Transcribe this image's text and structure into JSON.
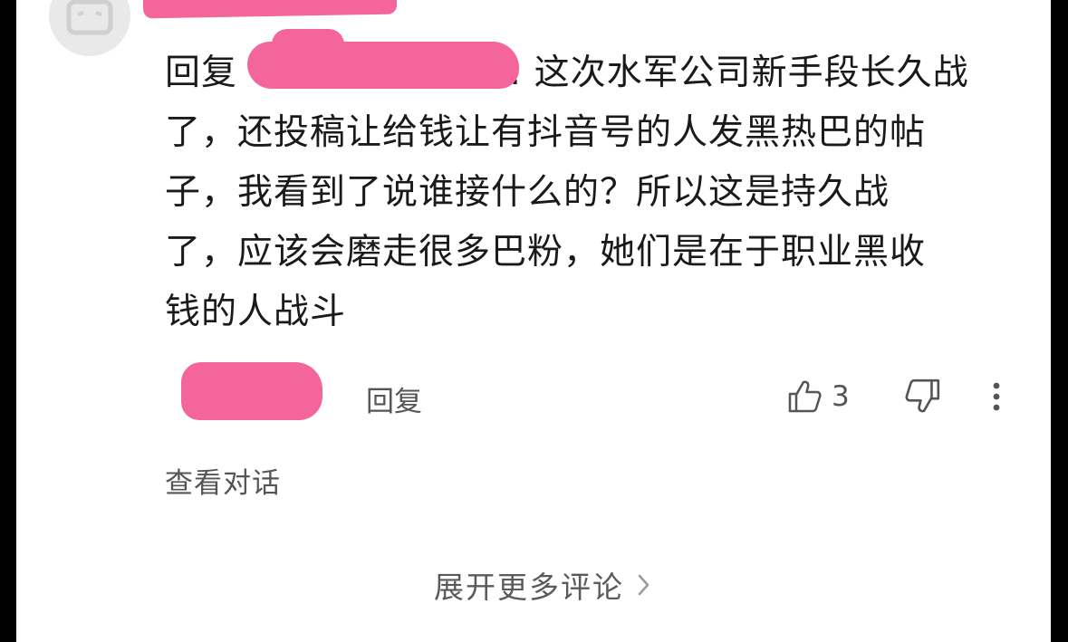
{
  "comment": {
    "reply_prefix": "回复",
    "mention_suffix": ":",
    "text": "这次水军公司新手段长久战了，还投稿让给钱让有抖音号的人发黑热巴的帖子，我看到了说谁接什么的？所以这是持久战了，应该会磨走很多巴粉，她们是在于职业黑收钱的人战斗",
    "lines": [
      "这次水军公司新手段长久战",
      "了，还投稿让给钱让有抖音号的人发黑热巴的帖",
      "子，我看到了说谁接什么的？所以这是持久战",
      "了，应该会磨走很多巴粉，她们是在于职业黑收",
      "钱的人战斗"
    ]
  },
  "actions": {
    "reply_label": "回复",
    "like_count": "3",
    "like_icon": "thumbs-up-icon",
    "dislike_icon": "thumbs-down-icon",
    "more_icon": "more-vertical-icon"
  },
  "view_conversation": "查看对话",
  "expand_more": "展开更多评论",
  "colors": {
    "redaction": "#f4669b",
    "text": "#1a1a1a",
    "secondary": "#555555"
  }
}
